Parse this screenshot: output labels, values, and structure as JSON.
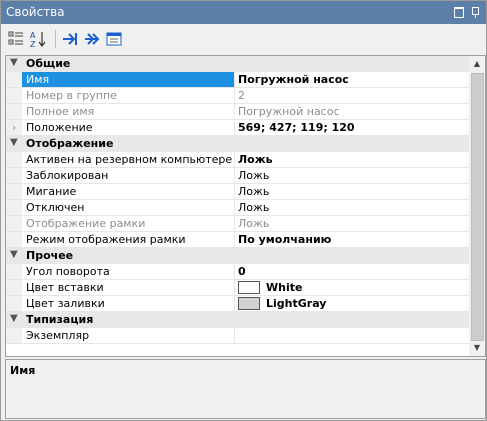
{
  "window": {
    "title": "Свойства"
  },
  "toolbar": {
    "items": [
      "categorized-icon",
      "sort-alpha-icon",
      "expand-icon",
      "collapse-icon",
      "property-pages-icon"
    ]
  },
  "categories": {
    "general": {
      "label": "Общие",
      "rows": {
        "name": {
          "label": "Имя",
          "value": "Погружной насос"
        },
        "group_number": {
          "label": "Номер в группе",
          "value": "2"
        },
        "full_name": {
          "label": "Полное имя",
          "value": "Погружной насос"
        },
        "position": {
          "label": "Положение",
          "value": "569; 427; 119; 120"
        }
      }
    },
    "display": {
      "label": "Отображение",
      "rows": {
        "active_backup": {
          "label": "Активен на резервном компьютере",
          "value": "Ложь"
        },
        "locked": {
          "label": "Заблокирован",
          "value": "Ложь"
        },
        "blinking": {
          "label": "Мигание",
          "value": "Ложь"
        },
        "disabled": {
          "label": "Отключен",
          "value": "Ложь"
        },
        "frame_display": {
          "label": "Отображение рамки",
          "value": "Ложь"
        },
        "frame_mode": {
          "label": "Режим отображения рамки",
          "value": "По умолчанию"
        }
      }
    },
    "other": {
      "label": "Прочее",
      "rows": {
        "rotation": {
          "label": "Угол поворота",
          "value": "0"
        },
        "insert_color": {
          "label": "Цвет вставки",
          "value": "White",
          "swatch": "#ffffff"
        },
        "fill_color": {
          "label": "Цвет заливки",
          "value": "LightGray",
          "swatch": "#d3d3d3"
        }
      }
    },
    "typing": {
      "label": "Типизация",
      "rows": {
        "instance": {
          "label": "Экземпляр",
          "value": ""
        }
      }
    }
  },
  "description": {
    "title": "Имя"
  },
  "colors": {
    "titlebar": "#5b7fa8",
    "selection": "#1e90e0",
    "category_bg": "#e8e8e8"
  }
}
